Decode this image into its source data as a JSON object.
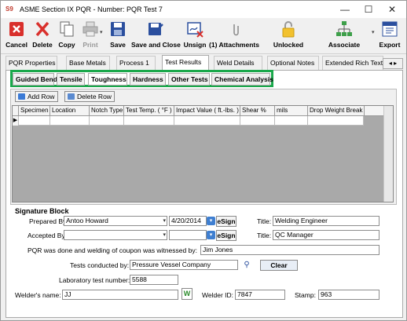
{
  "window": {
    "app_icon_text": "S9",
    "title": "ASME Section IX PQR -  Number: PQR Test 7",
    "controls": [
      "—",
      "☐",
      "✕"
    ]
  },
  "toolbar": {
    "cancel": "Cancel",
    "delete": "Delete",
    "copy": "Copy",
    "print": "Print",
    "save": "Save",
    "save_close": "Save and Close",
    "unsign": "Unsign",
    "attachments": "(1) Attachments",
    "unlocked": "Unlocked",
    "associate": "Associate",
    "export": "Export"
  },
  "tabs": [
    "PQR Properties",
    "Base Metals",
    "Process 1",
    "Test Results",
    "Weld Details",
    "Optional Notes",
    "Extended Rich Text"
  ],
  "tab_scroll": "◂ ▸",
  "subtabs": [
    "Guided Bend",
    "Tensile",
    "Toughness",
    "Hardness",
    "Other Tests",
    "Chemical Analysis"
  ],
  "grid": {
    "add_row": "Add Row",
    "delete_row": "Delete Row",
    "columns": [
      "Specimen",
      "Location",
      "Notch Type",
      "Test Temp. ( °F )",
      "Impact Value ( ft.-lbs. )",
      "Shear %",
      "mils",
      "Drop Weight Break"
    ],
    "row_marker": "▶"
  },
  "signature": {
    "heading": "Signature Block",
    "prepared_by_label": "Prepared By:",
    "prepared_by": "Antoo Howard",
    "prepared_date": "4/20/2014",
    "esign": "eSign",
    "title_label": "Title:",
    "prepared_title": "Welding Engineer",
    "accepted_by_label": "Accepted By:",
    "accepted_by": "",
    "accepted_date": "",
    "accepted_title": "QC Manager",
    "witness_label": "PQR was done and welding of coupon was witnessed by:",
    "witness": "Jim Jones",
    "conducted_label": "Tests conducted by:",
    "conducted": "Pressure Vessel Company",
    "clear": "Clear",
    "lab_label": "Laboratory test number:",
    "lab_number": "5588",
    "welder_name_label": "Welder's name:",
    "welder_name": "JJ",
    "welder_id_label": "Welder ID:",
    "welder_id": "7847",
    "stamp_label": "Stamp:",
    "stamp": "963"
  },
  "colors": {
    "highlight": "#1aa84b",
    "cancel_red": "#d9302c",
    "save_blue": "#2b4f9e"
  }
}
